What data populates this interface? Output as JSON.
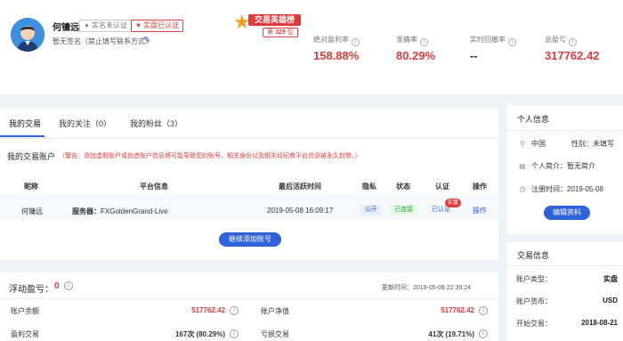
{
  "profile": {
    "name": "何镛远",
    "badge_realname": "实名未认证",
    "badge_firm": "实盘已认证",
    "signature": "暂无签名（禁止填写联系方式）"
  },
  "hero": {
    "title": "交易英雄榜",
    "rank_prefix": "第",
    "rank_value": "329",
    "rank_suffix": "位"
  },
  "stats": [
    {
      "label": "绝对盈利率",
      "value": "158.88%"
    },
    {
      "label": "准确率",
      "value": "80.29%"
    },
    {
      "label": "实时回撤率",
      "value": "--"
    },
    {
      "label": "总盈亏",
      "value": "317762.42"
    }
  ],
  "tabs": [
    {
      "label": "我的交易"
    },
    {
      "label": "我的关注（0）"
    },
    {
      "label": "我的粉丝（3）"
    }
  ],
  "account": {
    "title": "我的交易账户",
    "warning": "（警告：添加虚假账户或伪造账户信息将可能导致您的账号，相关身份以及相关经纪商平台信息被永久封禁。）",
    "headers": [
      "昵称",
      "平台信息",
      "最后活跃时间",
      "隐私",
      "状态",
      "认证",
      "操作"
    ],
    "row": {
      "nickname": "何镛远",
      "server_label": "服务器：",
      "server": "FXGoldenGrand-Live",
      "last_active": "2019-05-08 16:09:17",
      "privacy": "公开",
      "status": "已连接",
      "auth": "已认证",
      "real_tag": "实盘",
      "op": "操作"
    },
    "add_button": "继续添加账号"
  },
  "personal": {
    "title": "个人信息",
    "location": "中国",
    "gender": "性别：未填写",
    "intro": "个人简介：暂无简介",
    "reg": "注册时间：2019-05-08",
    "edit_button": "编辑资料"
  },
  "trade_info": {
    "title": "交易信息",
    "rows": [
      {
        "label": "账户类型：",
        "value": "实盘"
      },
      {
        "label": "账户货币：",
        "value": "USD"
      },
      {
        "label": "开始交易：",
        "value": "2018-08-21"
      }
    ]
  },
  "floating": {
    "title": "浮动盈亏：",
    "value": "0",
    "updated": "更新时间：2019-05-08 22:39:24",
    "rows": [
      {
        "left_label": "账户余额",
        "left_value": "517762.42",
        "right_label": "账户净值",
        "right_value": "517762.42"
      },
      {
        "left_label": "盈利交易",
        "left_value": "167次 (80.29%)",
        "right_label": "亏损交易",
        "right_value": "41次 (19.71%)"
      }
    ]
  },
  "colors": {
    "accent": "#2e62d9",
    "red": "#e2393a",
    "green": "#2ea243"
  }
}
